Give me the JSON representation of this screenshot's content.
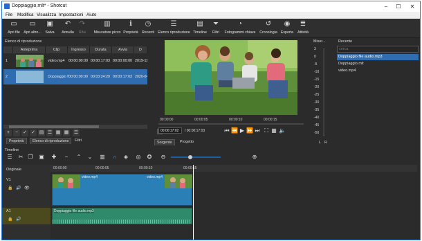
{
  "window": {
    "title": "Doppiaggio.mlt* - Shotcut",
    "minimize": "–",
    "maximize": "☐",
    "close": "✕"
  },
  "menu": [
    "File",
    "Modifica",
    "Visualizza",
    "Impostazioni",
    "Aiuto"
  ],
  "toolbar": [
    {
      "label": "Apri file",
      "icon": "open-file-icon",
      "glyph": "▭"
    },
    {
      "label": "Apri altro...",
      "icon": "open-other-icon",
      "glyph": "▭"
    },
    {
      "label": "Salva",
      "icon": "save-icon",
      "glyph": "▣"
    },
    {
      "label": "Annulla",
      "icon": "undo-icon",
      "glyph": "↶"
    },
    {
      "label": "Rifai",
      "icon": "redo-icon",
      "glyph": "↷"
    },
    {
      "label": "Misuratore picco",
      "icon": "peak-meter-icon",
      "glyph": "▥"
    },
    {
      "label": "Proprietà",
      "icon": "properties-icon",
      "glyph": "ℹ"
    },
    {
      "label": "Recenti",
      "icon": "recent-icon",
      "glyph": "◷"
    },
    {
      "label": "Elenco riproduzione",
      "icon": "playlist-icon",
      "glyph": "☰"
    },
    {
      "label": "Timeline",
      "icon": "timeline-icon",
      "glyph": "▤"
    },
    {
      "label": "Filtri",
      "icon": "filter-icon",
      "glyph": "⏷"
    },
    {
      "label": "Fotogrammi chiave",
      "icon": "keyframes-icon",
      "glyph": "◔"
    },
    {
      "label": "Cronologia",
      "icon": "history-icon",
      "glyph": "↺"
    },
    {
      "label": "Esporta",
      "icon": "export-icon",
      "glyph": "◉"
    },
    {
      "label": "Attività",
      "icon": "jobs-icon",
      "glyph": "≣"
    }
  ],
  "playlist": {
    "title": "Elenco di riproduzione",
    "columns": [
      "Anteprima",
      "Clip",
      "Ingresso",
      "Durata",
      "Avvia",
      "D"
    ],
    "rows": [
      {
        "num": "1",
        "clip": "video.mp4",
        "in": "00:00:00:00",
        "duration": "00:00:17:03",
        "start": "00:00:00:00",
        "date": "2019-11-"
      },
      {
        "num": "2",
        "clip": "Doppiaggio file audio.mp3",
        "in": "00:00:00:00",
        "duration": "00:03:24:20",
        "start": "00:00:17:03",
        "date": "2020-04-"
      }
    ],
    "tabs": [
      "Proprietà",
      "Elenco di riproduzione",
      "Filtri"
    ]
  },
  "player": {
    "scale": [
      "00:00:00",
      "00:00:05",
      "00:00:10",
      "00:00:15"
    ],
    "position": "00:00:17:02",
    "duration": "/ 00:00:17:03",
    "tabs": [
      "Sorgente",
      "Progetto"
    ]
  },
  "meter": {
    "title": "Misur...",
    "ticks": [
      "3",
      "0",
      "-5",
      "-10",
      "-15",
      "-20",
      "-25",
      "-30",
      "-35",
      "-40",
      "-45",
      "-50"
    ],
    "channels": [
      "L",
      "R"
    ],
    "bottom_num": "-50"
  },
  "recent": {
    "title": "Recente",
    "search_placeholder": "cerca",
    "items": [
      "Doppiaggio file audio.mp3",
      "Doppiaggio.mlt",
      "video.mp4"
    ]
  },
  "timeline": {
    "title": "Timeline",
    "ruler": [
      "00:00:00",
      "00:00:05",
      "00:00:10",
      "00:00:15"
    ],
    "tracks": [
      {
        "name": "Originale"
      },
      {
        "name": "V1"
      },
      {
        "name": "A1"
      }
    ],
    "video_clip": "video.mp4",
    "video_clip_end": "video.mp4",
    "audio_clip": "Doppiaggio file audio.mp3"
  },
  "colors": {
    "accent": "#1e5fa8",
    "video_clip": "#2a7fb6",
    "audio_clip": "#2e8a6a",
    "selected_row": "#2f6db0"
  }
}
